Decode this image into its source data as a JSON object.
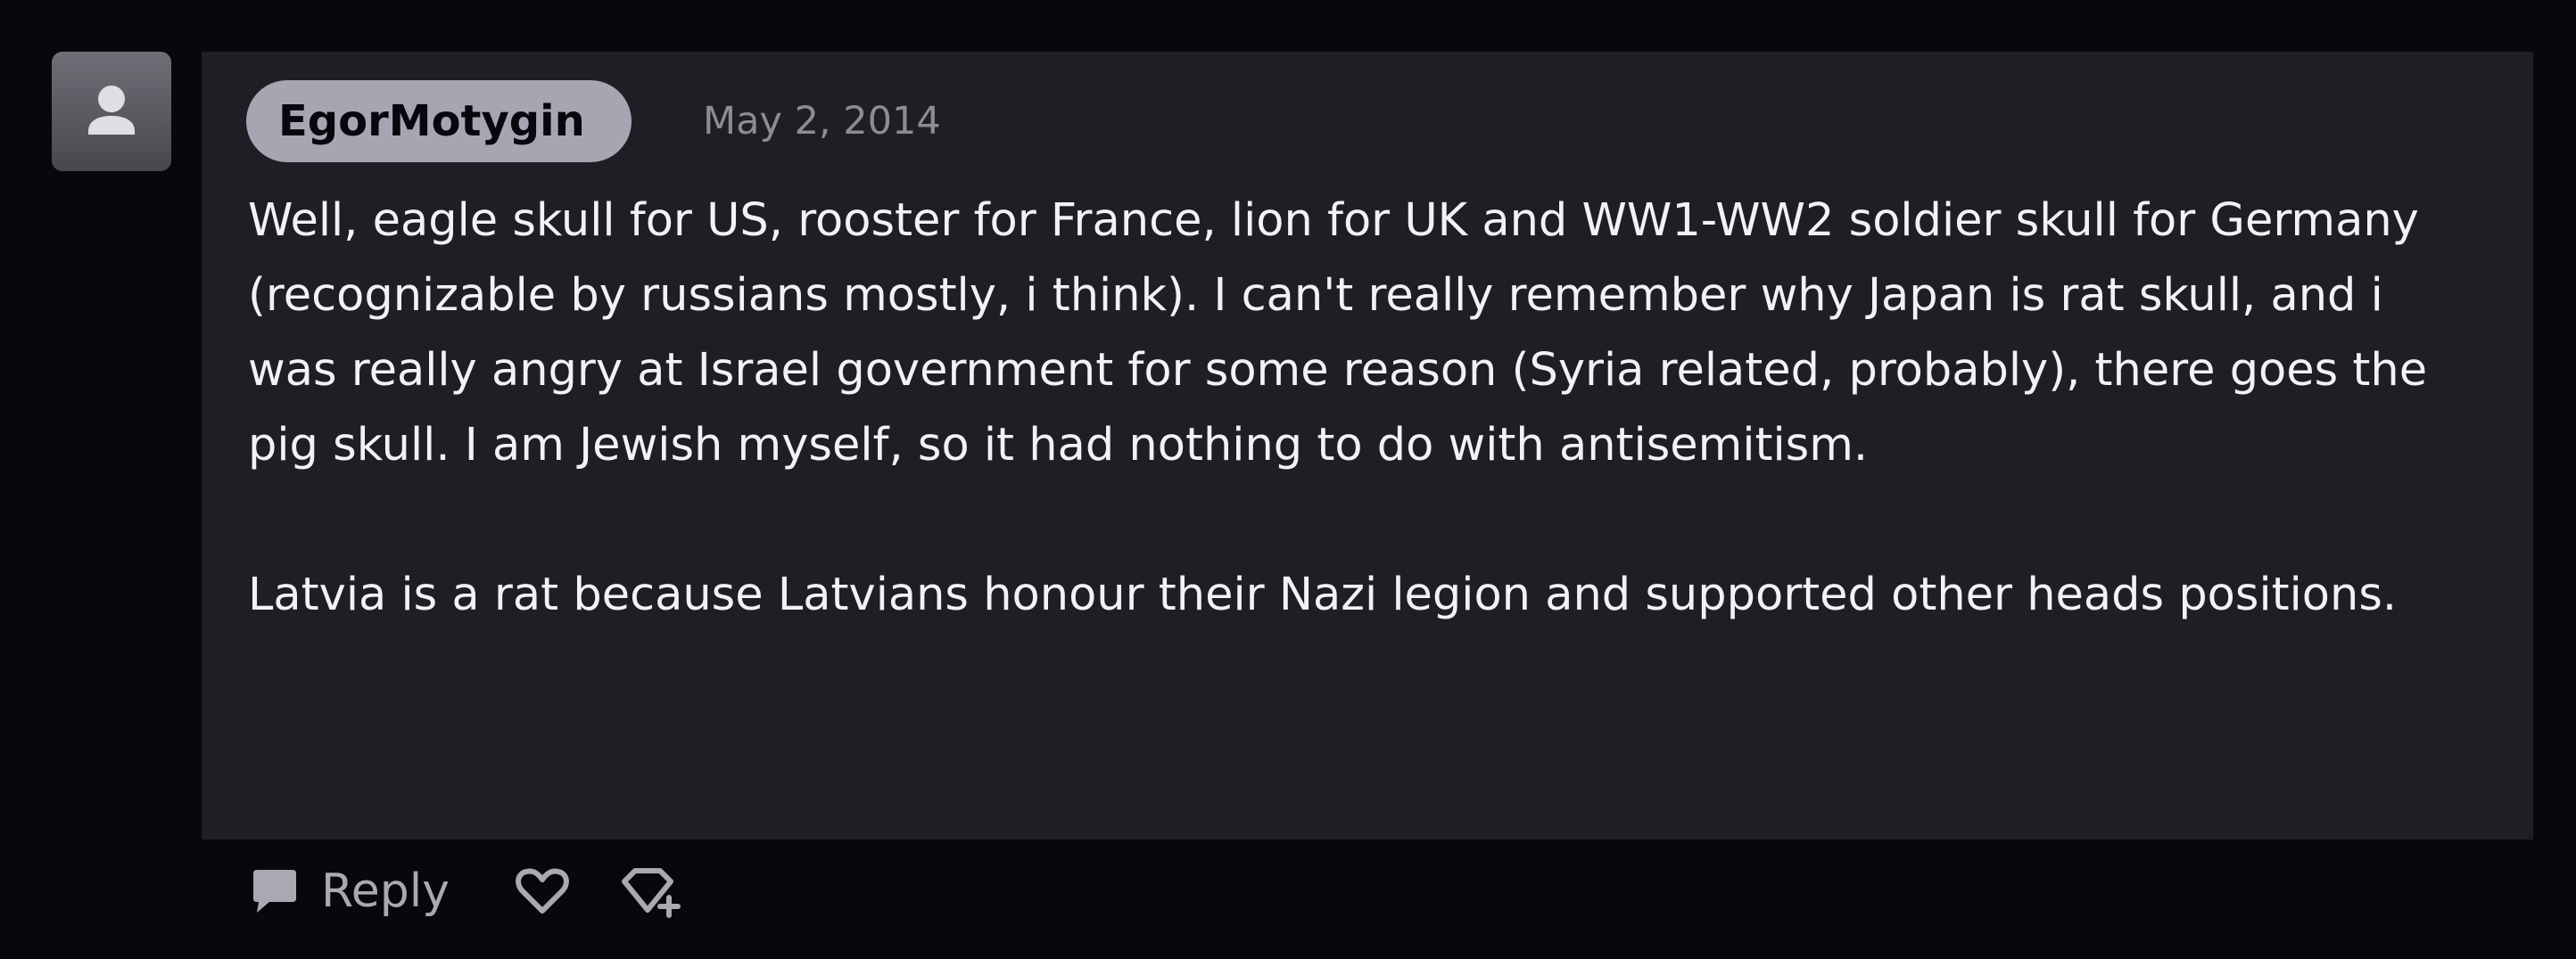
{
  "comment": {
    "author": "EgorMotygin",
    "date": "May 2, 2014",
    "paragraphs": [
      "Well, eagle skull for US, rooster for France, lion for UK and WW1-WW2 soldier skull for Germany (recognizable by russians mostly, i think). I can't really remember why Japan is rat skull, and i was really angry at Israel government for some reason (Syria related, probably), there goes the pig skull. I am Jewish myself, so it had nothing to do with antisemitism.",
      "Latvia is a rat because Latvians honour their Nazi legion and supported other heads positions."
    ]
  },
  "actions": {
    "reply_label": "Reply",
    "reply_icon": "speech-bubble-icon",
    "like_icon": "heart-icon",
    "award_icon": "gem-plus-icon"
  },
  "colors": {
    "background": "#07080d",
    "card": "#1e1f24",
    "username_pill": "#a6a6b3",
    "date_text": "#8b8c94",
    "body_text": "#f2f2f5",
    "action_icon": "#a9a9b1"
  }
}
